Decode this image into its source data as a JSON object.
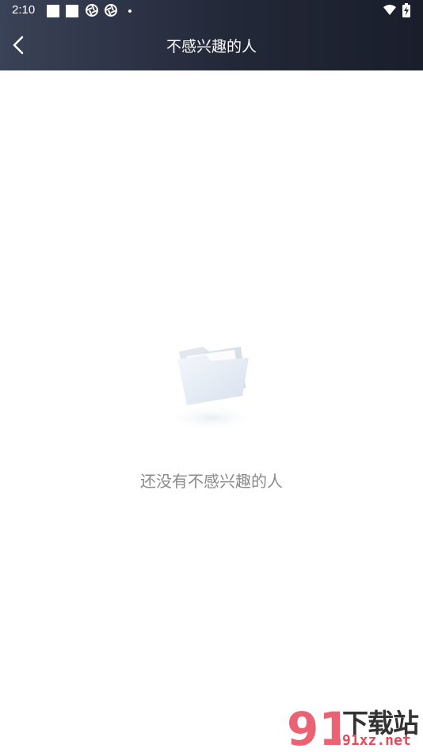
{
  "status_bar": {
    "time": "2:10",
    "icons": [
      "square-icon",
      "square-icon",
      "aperture-icon",
      "aperture-icon",
      "dot-icon",
      "wifi-icon",
      "battery-charging-icon"
    ]
  },
  "header": {
    "back_icon": "chevron-left-icon",
    "title": "不感兴趣的人"
  },
  "empty_state": {
    "icon": "folder-icon",
    "message": "还没有不感兴趣的人"
  },
  "watermark": {
    "logo_text": "91",
    "brand": "下载站",
    "url": "91xz.net",
    "color": "#e8485a"
  },
  "colors": {
    "header_gradient_start": "#3a4257",
    "header_gradient_end": "#1a1e2b",
    "empty_text": "#8a8a8a"
  }
}
